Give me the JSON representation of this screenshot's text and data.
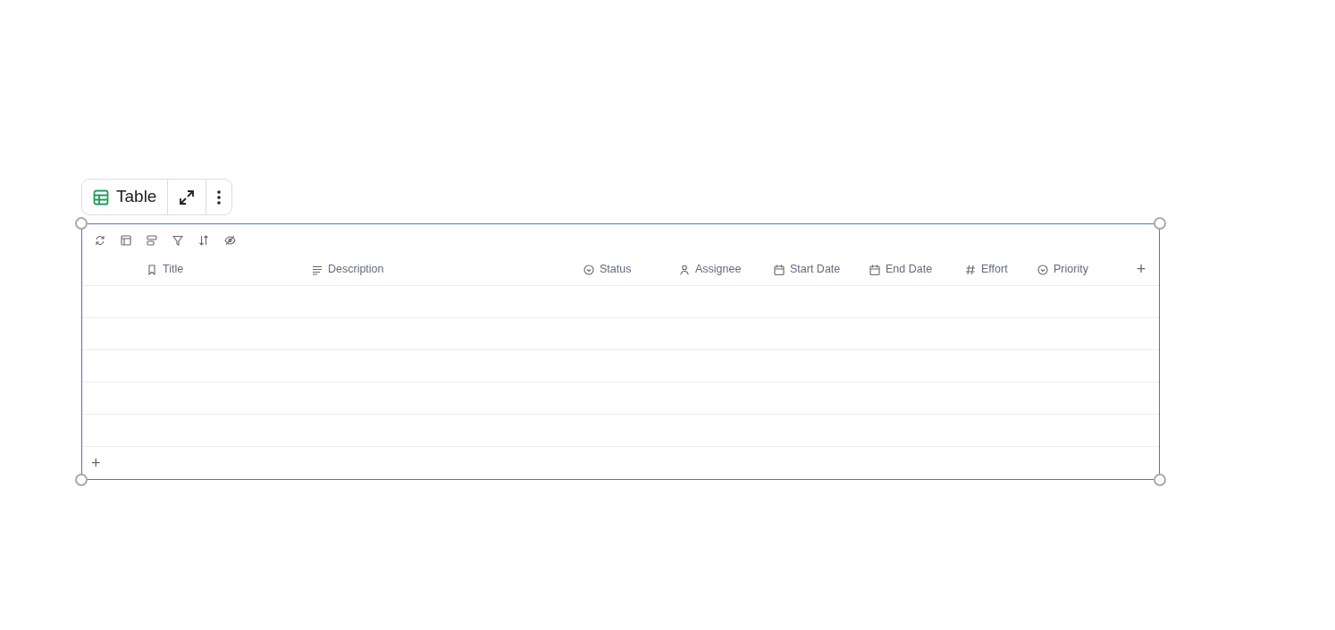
{
  "block_toolbar": {
    "label": "Table"
  },
  "table": {
    "columns": [
      {
        "title": "Title",
        "kind": "title"
      },
      {
        "title": "Description",
        "kind": "text"
      },
      {
        "title": "Status",
        "kind": "select"
      },
      {
        "title": "Assignee",
        "kind": "person"
      },
      {
        "title": "Start Date",
        "kind": "date"
      },
      {
        "title": "End Date",
        "kind": "date"
      },
      {
        "title": "Effort",
        "kind": "number"
      },
      {
        "title": "Priority",
        "kind": "select"
      }
    ],
    "add_column": "+",
    "add_row": "+"
  }
}
